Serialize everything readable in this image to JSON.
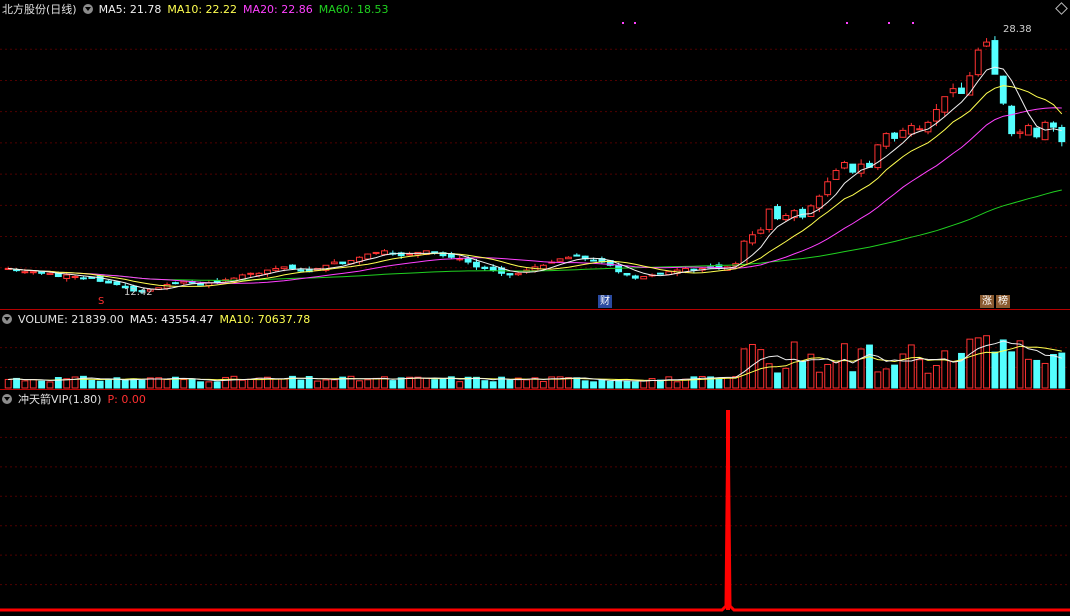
{
  "price_panel": {
    "stock_name": "北方股份(日线)",
    "ma5": {
      "label": "MA5:",
      "value": "21.78",
      "color": "#f0f0f0"
    },
    "ma10": {
      "label": "MA10:",
      "value": "22.22",
      "color": "#ffff50"
    },
    "ma20": {
      "label": "MA20:",
      "value": "22.86",
      "color": "#ff40ff"
    },
    "ma60": {
      "label": "MA60:",
      "value": "18.53",
      "color": "#20d020"
    },
    "high_label": "28.38",
    "low_label": "12.42",
    "markers": {
      "s_badge": "S",
      "cai_badge": "财",
      "zhang_badge": "涨",
      "bang_badge": "榜"
    }
  },
  "volume_panel": {
    "title": "VOLUME:",
    "value": "21839.00",
    "ma5": {
      "label": "MA5:",
      "value": "43554.47"
    },
    "ma10": {
      "label": "MA10:",
      "value": "70637.78"
    }
  },
  "indicator_panel": {
    "title": "冲天箭VIP(1.80)",
    "p_label": "P:",
    "p_value": "0.00"
  },
  "colors": {
    "up": "#ff3232",
    "down": "#54ffff",
    "grid": "#500000",
    "ma5": "#f0f0f0",
    "ma10": "#ffff50",
    "ma20": "#ff40ff",
    "ma60": "#20d020",
    "signal": "#ff0000"
  },
  "chart_data": {
    "type": "candlestick",
    "closes": [
      13.9,
      13.8,
      13.7,
      13.7,
      13.6,
      13.6,
      13.4,
      13.5,
      13.4,
      13.3,
      13.3,
      13.1,
      13.0,
      12.9,
      12.7,
      12.5,
      12.45,
      12.6,
      12.7,
      12.9,
      13.0,
      13.1,
      13.0,
      12.9,
      13.0,
      13.1,
      13.2,
      13.3,
      13.5,
      13.6,
      13.6,
      13.8,
      13.9,
      14.0,
      13.9,
      13.8,
      13.7,
      13.9,
      14.1,
      14.3,
      14.2,
      14.4,
      14.6,
      14.8,
      14.9,
      15.0,
      14.8,
      14.7,
      14.8,
      14.9,
      15.0,
      14.9,
      14.7,
      14.6,
      14.5,
      14.3,
      14.0,
      13.9,
      13.8,
      13.6,
      13.5,
      13.6,
      13.8,
      14.0,
      14.1,
      14.3,
      14.5,
      14.6,
      14.7,
      14.5,
      14.4,
      14.3,
      14.1,
      13.7,
      13.5,
      13.3,
      13.4,
      13.5,
      13.6,
      13.7,
      13.8,
      13.9,
      13.8,
      13.9,
      14.0,
      13.9,
      14.0,
      14.2,
      15.6,
      16.0,
      16.3,
      17.6,
      17.0,
      17.2,
      17.5,
      17.1,
      17.8,
      18.4,
      19.3,
      20.0,
      20.5,
      19.9,
      20.4,
      20.2,
      21.6,
      22.3,
      22.0,
      22.5,
      22.8,
      22.6,
      23.0,
      23.8,
      24.6,
      25.1,
      24.8,
      25.9,
      27.5,
      28.0,
      26.0,
      24.2,
      22.3,
      22.4,
      22.8,
      22.1,
      23.0,
      22.7,
      21.8
    ]
  }
}
